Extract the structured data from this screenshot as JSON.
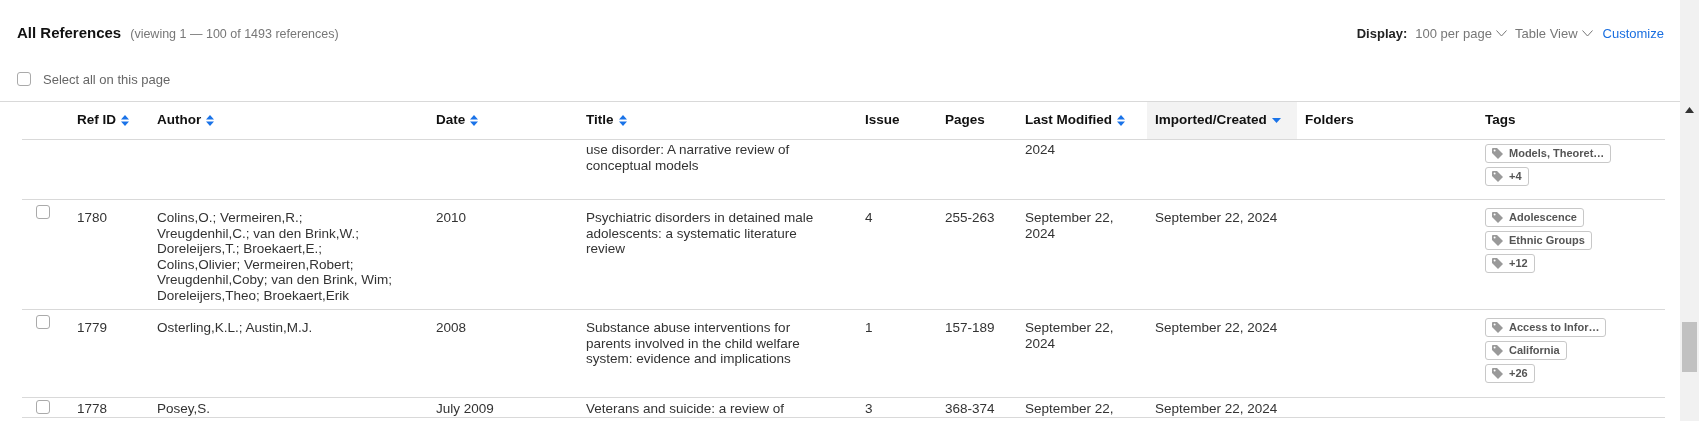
{
  "header": {
    "title": "All References",
    "subtitle": "(viewing 1 — 100 of 1493 references)",
    "display_label": "Display:",
    "dropdowns": [
      "100 per page",
      "Table View"
    ],
    "customize_link": "Customize"
  },
  "select_all": {
    "label": "Select all on this page",
    "checked": false
  },
  "table": {
    "columns": [
      {
        "label": "Ref ID",
        "kind": "sortable",
        "selected": false
      },
      {
        "label": "Author",
        "kind": "sortable",
        "selected": false
      },
      {
        "label": "Date",
        "kind": "sortable",
        "selected": false
      },
      {
        "label": "Title",
        "kind": "sortable",
        "selected": false
      },
      {
        "label": "Issue",
        "kind": "plain",
        "selected": false
      },
      {
        "label": "Pages",
        "kind": "plain",
        "selected": false
      },
      {
        "label": "Last Modified",
        "kind": "sortable",
        "selected": false
      },
      {
        "label": "Imported/Created",
        "kind": "sorted",
        "selected": true
      },
      {
        "label": "Folders",
        "kind": "plain",
        "selected": false
      },
      {
        "label": "Tags",
        "kind": "plain",
        "selected": false
      }
    ],
    "rows": [
      {
        "kind": "partial",
        "cells": [
          null,
          null,
          null,
          "use disorder: A narrative review of conceptual models",
          null,
          null,
          "2024",
          null,
          null
        ],
        "tags": [
          "Models, Theoret…",
          "+4"
        ]
      },
      {
        "kind": "full",
        "checked": false,
        "cells": [
          "1780",
          "Colins,O.; Vermeiren,R.; Vreugdenhil,C.; van den Brink,W.; Doreleijers,T.; Broekaert,E.; Colins,Olivier; Vermeiren,Robert; Vreugdenhil,Coby; van den Brink, Wim; Doreleijers,Theo; Broekaert,Erik",
          "2010",
          "Psychiatric disorders in detained male adolescents: a systematic literature review",
          "4",
          "255-263",
          "September 22, 2024",
          "September 22, 2024",
          null
        ],
        "tags": [
          "Adolescence",
          "Ethnic Groups",
          "+12"
        ]
      },
      {
        "kind": "full",
        "checked": false,
        "cells": [
          "1779",
          "Osterling,K.L.; Austin,M.J.",
          "2008",
          "Substance abuse interventions for parents involved in the child welfare system: evidence and implications",
          "1",
          "157-189",
          "September 22, 2024",
          "September 22, 2024",
          null
        ],
        "tags": [
          "Access to Infor…",
          "California",
          "+26"
        ]
      },
      {
        "kind": "cut",
        "checked": false,
        "cells": [
          "1778",
          "Posey,S.",
          "July 2009",
          "Veterans and suicide: a review of",
          "3",
          "368-374",
          "September 22,",
          "September 22, 2024",
          null
        ]
      }
    ]
  }
}
